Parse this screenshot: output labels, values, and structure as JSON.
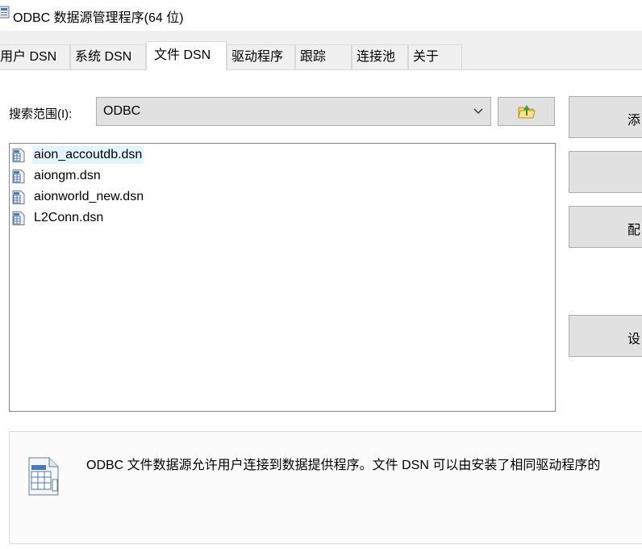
{
  "window": {
    "title": "ODBC 数据源管理程序(64 位)"
  },
  "tabs": [
    {
      "label": "用户 DSN",
      "active": false
    },
    {
      "label": "系统 DSN",
      "active": false
    },
    {
      "label": "文件 DSN",
      "active": true
    },
    {
      "label": "驱动程序",
      "active": false
    },
    {
      "label": "跟踪",
      "active": false
    },
    {
      "label": "连接池",
      "active": false
    },
    {
      "label": "关于",
      "active": false
    }
  ],
  "search": {
    "label": "搜索范围(I):",
    "value": "ODBC",
    "dropdown_icon": "chevron-down-icon",
    "up_folder_icon": "folder-up-icon"
  },
  "files": [
    {
      "name": "aion_accoutdb.dsn",
      "selected": true,
      "icon": "dsn-file-icon"
    },
    {
      "name": "aiongm.dsn",
      "selected": false,
      "icon": "dsn-file-icon"
    },
    {
      "name": "aionworld_new.dsn",
      "selected": false,
      "icon": "dsn-file-icon"
    },
    {
      "name": "L2Conn.dsn",
      "selected": false,
      "icon": "dsn-file-icon"
    }
  ],
  "right_buttons": [
    {
      "label": "添"
    },
    {
      "label": ""
    },
    {
      "label": "配"
    },
    {
      "label": "设"
    }
  ],
  "description": {
    "icon": "dsn-file-large-icon",
    "text": "ODBC 文件数据源允许用户连接到数据提供程序。文件 DSN 可以由安装了相同驱动程序的"
  },
  "colors": {
    "selection": "#e5f3ff",
    "button_face": "#e1e1e1",
    "tab_bg": "#f0f0f0"
  }
}
